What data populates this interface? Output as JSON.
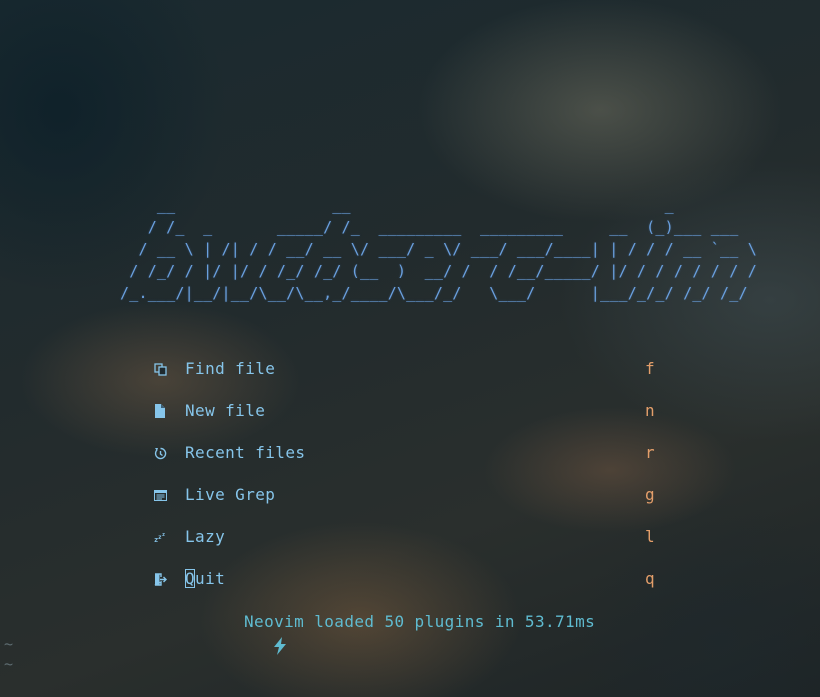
{
  "banner": {
    "lines": [
      "                 __                 __                                  _",
      "                / /_  _       _____/ /_  _________  _________     __  (_)___ ___",
      "               / __ \\ | /| / / __/ __ \\/ ___/ _ \\/ ___/ ___/____| | / / / __ `__ \\",
      "              / /_/ / |/ |/ / /_/ /_/ (__  )  __/ /  / /__/_____/ |/ / / / / / / /",
      "             /_.___/|__/|__/\\__/\\__,_/____/\\___/_/   \\___/      |___/_/_/ /_/ /_/"
    ]
  },
  "menu": [
    {
      "icon": "find-file-icon",
      "label": "Find file",
      "key": "f"
    },
    {
      "icon": "new-file-icon",
      "label": "New file",
      "key": "n"
    },
    {
      "icon": "recent-files-icon",
      "label": "Recent files",
      "key": "r"
    },
    {
      "icon": "live-grep-icon",
      "label": "Live Grep",
      "key": "g"
    },
    {
      "icon": "lazy-icon",
      "label": "Lazy",
      "key": "l"
    },
    {
      "icon": "quit-icon",
      "label": "Quit",
      "key": "q",
      "cursor_char": "Q",
      "label_rest": "uit"
    }
  ],
  "footer": {
    "icon": "lightning-bolt-icon",
    "text": "Neovim loaded 50 plugins in 53.71ms"
  },
  "empty_lines": [
    "~",
    "~"
  ],
  "colors": {
    "banner": "#6aa0de",
    "menu_text": "#86c5ea",
    "key": "#e39e6a",
    "footer": "#5fbbd0",
    "tilde": "#5d6b70"
  }
}
